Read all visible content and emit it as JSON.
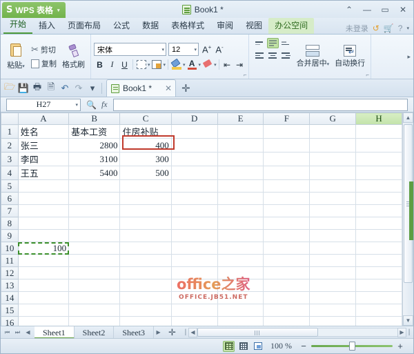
{
  "titlebar": {
    "app_name": "WPS 表格",
    "logo_glyph": "S",
    "dropdown_caret": "▾",
    "doc_title": "Book1 *",
    "window_buttons": [
      {
        "name": "collapse-ribbon-button",
        "glyph": "⌃"
      },
      {
        "name": "minimize-button",
        "glyph": "—"
      },
      {
        "name": "maximize-button",
        "glyph": "▭"
      },
      {
        "name": "close-button",
        "glyph": "✕"
      }
    ]
  },
  "ribbon_tabs": [
    {
      "label": "开始",
      "active": true
    },
    {
      "label": "插入",
      "active": false
    },
    {
      "label": "页面布局",
      "active": false
    },
    {
      "label": "公式",
      "active": false
    },
    {
      "label": "数据",
      "active": false
    },
    {
      "label": "表格样式",
      "active": false
    },
    {
      "label": "审阅",
      "active": false
    },
    {
      "label": "视图",
      "active": false
    },
    {
      "label": "办公空间",
      "active": false,
      "special": true
    }
  ],
  "ribbon_right": {
    "login_label": "未登录",
    "sync_icon": "↺",
    "cart_icon": "🛒",
    "help_icon": "?",
    "help_caret": "▾"
  },
  "ribbon": {
    "clipboard": {
      "paste_label": "粘贴",
      "paste_caret": "▾",
      "cut_label": "剪切",
      "copy_label": "复制",
      "format_painter_label": "格式刷"
    },
    "font": {
      "font_name": "宋体",
      "font_size": "12",
      "caret": "▾",
      "grow_font": "A",
      "grow_sup": "+",
      "shrink_font": "A",
      "shrink_sup": "-",
      "bold": "B",
      "italic": "I",
      "underline": "U"
    },
    "alignment": {
      "merge_center_label": "合并居中",
      "merge_caret": "▾",
      "wrap_text_label": "自动换行"
    },
    "more_caret": "▸",
    "dialog_launcher": "⌐"
  },
  "quick_access": {
    "buttons": [
      {
        "name": "open-button",
        "glyph": "🗁"
      },
      {
        "name": "save-button",
        "glyph": "💾"
      },
      {
        "name": "print-button",
        "glyph": "🖶"
      },
      {
        "name": "print-preview-button",
        "glyph": "🗎"
      },
      {
        "name": "undo-button",
        "glyph": "↶"
      },
      {
        "name": "redo-button",
        "glyph": "↷"
      },
      {
        "name": "customize-qat-button",
        "glyph": "▾"
      }
    ],
    "doc_tab_label": "Book1 *",
    "doc_tab_close": "✕",
    "new_tab": "✛"
  },
  "formula_bar": {
    "name_box_value": "H27",
    "name_box_caret": "▾",
    "search_icon": "🔍",
    "fx_icon": "fx",
    "formula_value": "",
    "formula_placeholder": ""
  },
  "grid": {
    "columns": [
      "A",
      "B",
      "C",
      "D",
      "E",
      "F",
      "G",
      "H"
    ],
    "active_column": "H",
    "rows": [
      1,
      2,
      3,
      4,
      5,
      6,
      7,
      8,
      9,
      10,
      11,
      12,
      13,
      14,
      15,
      16
    ],
    "cells": [
      {
        "row": 1,
        "A": "姓名",
        "B": "基本工资",
        "C": "住房补贴",
        "D": "",
        "E": "",
        "F": "",
        "G": "",
        "H": ""
      },
      {
        "row": 2,
        "A": "张三",
        "B": "2800",
        "C": "400",
        "D": "",
        "E": "",
        "F": "",
        "G": "",
        "H": ""
      },
      {
        "row": 3,
        "A": "李四",
        "B": "3100",
        "C": "300",
        "D": "",
        "E": "",
        "F": "",
        "G": "",
        "H": ""
      },
      {
        "row": 4,
        "A": "王五",
        "B": "5400",
        "C": "500",
        "D": "",
        "E": "",
        "F": "",
        "G": "",
        "H": ""
      },
      {
        "row": 5,
        "A": "",
        "B": "",
        "C": "",
        "D": "",
        "E": "",
        "F": "",
        "G": "",
        "H": ""
      },
      {
        "row": 6,
        "A": "",
        "B": "",
        "C": "",
        "D": "",
        "E": "",
        "F": "",
        "G": "",
        "H": ""
      },
      {
        "row": 7,
        "A": "",
        "B": "",
        "C": "",
        "D": "",
        "E": "",
        "F": "",
        "G": "",
        "H": ""
      },
      {
        "row": 8,
        "A": "",
        "B": "",
        "C": "",
        "D": "",
        "E": "",
        "F": "",
        "G": "",
        "H": ""
      },
      {
        "row": 9,
        "A": "",
        "B": "",
        "C": "",
        "D": "",
        "E": "",
        "F": "",
        "G": "",
        "H": ""
      },
      {
        "row": 10,
        "A": "100",
        "B": "",
        "C": "",
        "D": "",
        "E": "",
        "F": "",
        "G": "",
        "H": ""
      },
      {
        "row": 11,
        "A": "",
        "B": "",
        "C": "",
        "D": "",
        "E": "",
        "F": "",
        "G": "",
        "H": ""
      },
      {
        "row": 12,
        "A": "",
        "B": "",
        "C": "",
        "D": "",
        "E": "",
        "F": "",
        "G": "",
        "H": ""
      },
      {
        "row": 13,
        "A": "",
        "B": "",
        "C": "",
        "D": "",
        "E": "",
        "F": "",
        "G": "",
        "H": ""
      },
      {
        "row": 14,
        "A": "",
        "B": "",
        "C": "",
        "D": "",
        "E": "",
        "F": "",
        "G": "",
        "H": ""
      },
      {
        "row": 15,
        "A": "",
        "B": "",
        "C": "",
        "D": "",
        "E": "",
        "F": "",
        "G": "",
        "H": ""
      },
      {
        "row": 16,
        "A": "",
        "B": "",
        "C": "",
        "D": "",
        "E": "",
        "F": "",
        "G": "",
        "H": ""
      }
    ],
    "numeric_columns": [
      "B",
      "C"
    ],
    "copied_cell": "A10",
    "highlighted_cell": "C2",
    "highlight_color": "#c0392b",
    "marquee_color": "#3a8f2a",
    "active_column_color": "#c3e3aa"
  },
  "watermark": {
    "line1": "office之家",
    "line2": "OFFICE.JB51.NET"
  },
  "sheet_bar": {
    "nav_first": "⏮",
    "nav_prev_group": "⏭",
    "nav_prev": "◀",
    "tabs": [
      {
        "label": "Sheet1",
        "active": true
      },
      {
        "label": "Sheet2",
        "active": false
      },
      {
        "label": "Sheet3",
        "active": false
      }
    ],
    "nav_next": "▶",
    "add_sheet": "✛",
    "hscroll_left": "◀",
    "hscroll_right": "▶",
    "thumb_grip": "⦙⦙⦙"
  },
  "statusbar": {
    "status_text": "",
    "view_buttons": [
      {
        "name": "normal-view-button",
        "active": true
      },
      {
        "name": "page-break-view-button",
        "active": false
      },
      {
        "name": "page-layout-view-button",
        "active": false
      }
    ],
    "zoom_label": "100 %",
    "zoom_out": "−",
    "zoom_in": "+",
    "zoom_percent": 100
  },
  "scrollbar": {
    "up_arrow": "▲",
    "down_arrow": "▼"
  }
}
